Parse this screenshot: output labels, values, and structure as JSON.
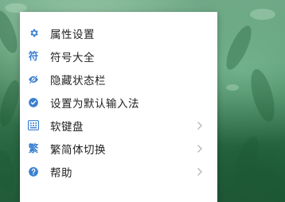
{
  "colors": {
    "accent": "#3a7fd0",
    "menu_bg": "#ffffff",
    "text": "#222222",
    "chevron": "#b8b8b8"
  },
  "menu": {
    "items": [
      {
        "label": "属性设置",
        "icon": "gear-icon",
        "has_submenu": false
      },
      {
        "label": "符号大全",
        "icon": "symbol-glyph-icon",
        "glyph": "符",
        "has_submenu": false
      },
      {
        "label": "隐藏状态栏",
        "icon": "eye-hidden-icon",
        "has_submenu": false
      },
      {
        "label": "设置为默认输入法",
        "icon": "default-ime-icon",
        "has_submenu": false
      },
      {
        "label": "软键盘",
        "icon": "keyboard-icon",
        "has_submenu": true
      },
      {
        "label": "繁简体切换",
        "icon": "traditional-simplified-glyph-icon",
        "glyph": "繁",
        "has_submenu": true
      },
      {
        "label": "帮助",
        "icon": "help-icon",
        "has_submenu": true
      }
    ]
  }
}
